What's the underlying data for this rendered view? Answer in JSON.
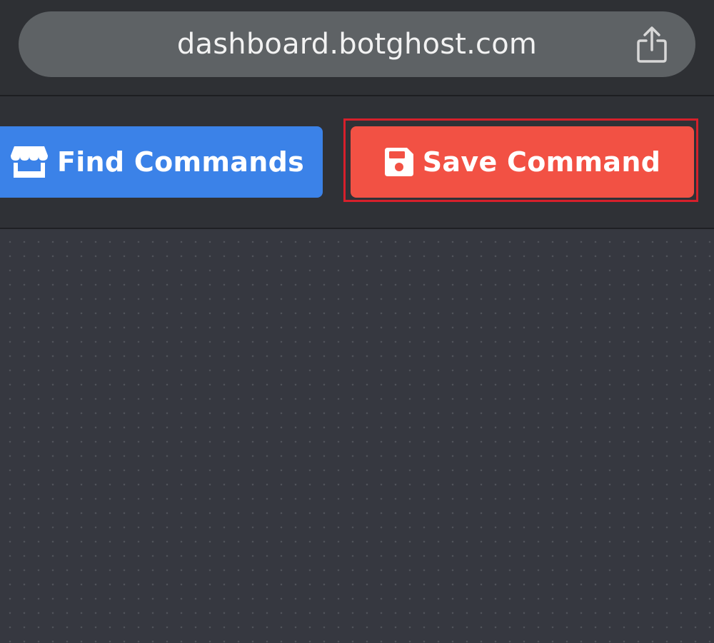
{
  "browser": {
    "url": "dashboard.botghost.com",
    "share_icon": "share-icon"
  },
  "toolbar": {
    "find_label": "Find Commands",
    "find_icon": "store-icon",
    "save_label": "Save Command",
    "save_icon": "floppy-disk-icon"
  },
  "colors": {
    "find_button": "#3b82e8",
    "save_button": "#f25144",
    "highlight": "#d6202b",
    "canvas_bg": "#363840"
  }
}
